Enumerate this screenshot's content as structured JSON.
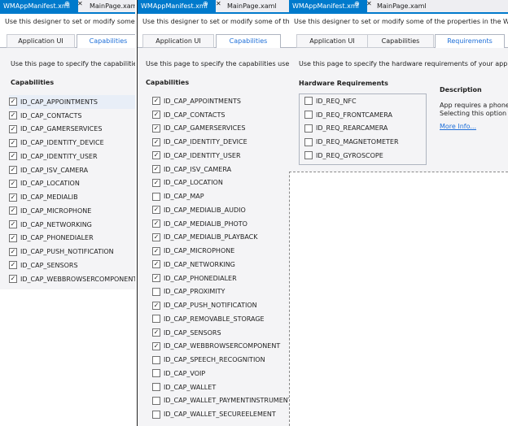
{
  "doc_tabs": {
    "manifest": "WMAppManifest.xml",
    "mainpage": "MainPage.xaml",
    "pin": "⊕",
    "close": "✕"
  },
  "designer_desc": "Use this designer to set or modify some of the properties in the Windows Phone",
  "designer_desc_short1": "Use this designer to set or modify some of the",
  "designer_desc_short2": "Use this designer to set or modify some of the proper",
  "tabs": {
    "app_ui": "Application UI",
    "capabilities": "Capabilities",
    "requirements": "Requirements"
  },
  "capabilities_page": {
    "intro": "Use this page to specify the capabilities used by you",
    "intro_short": "Use this page to specify the capabilities used",
    "section": "Capabilities"
  },
  "panel1_caps": [
    {
      "label": "ID_CAP_APPOINTMENTS",
      "checked": true
    },
    {
      "label": "ID_CAP_CONTACTS",
      "checked": true
    },
    {
      "label": "ID_CAP_GAMERSERVICES",
      "checked": true
    },
    {
      "label": "ID_CAP_IDENTITY_DEVICE",
      "checked": true
    },
    {
      "label": "ID_CAP_IDENTITY_USER",
      "checked": true
    },
    {
      "label": "ID_CAP_ISV_CAMERA",
      "checked": true
    },
    {
      "label": "ID_CAP_LOCATION",
      "checked": true
    },
    {
      "label": "ID_CAP_MEDIALIB",
      "checked": true
    },
    {
      "label": "ID_CAP_MICROPHONE",
      "checked": true
    },
    {
      "label": "ID_CAP_NETWORKING",
      "checked": true
    },
    {
      "label": "ID_CAP_PHONEDIALER",
      "checked": true
    },
    {
      "label": "ID_CAP_PUSH_NOTIFICATION",
      "checked": true
    },
    {
      "label": "ID_CAP_SENSORS",
      "checked": true
    },
    {
      "label": "ID_CAP_WEBBROWSERCOMPONENT",
      "checked": true
    }
  ],
  "panel2_caps": [
    {
      "label": "ID_CAP_APPOINTMENTS",
      "checked": true
    },
    {
      "label": "ID_CAP_CONTACTS",
      "checked": true
    },
    {
      "label": "ID_CAP_GAMERSERVICES",
      "checked": true
    },
    {
      "label": "ID_CAP_IDENTITY_DEVICE",
      "checked": true
    },
    {
      "label": "ID_CAP_IDENTITY_USER",
      "checked": true
    },
    {
      "label": "ID_CAP_ISV_CAMERA",
      "checked": true
    },
    {
      "label": "ID_CAP_LOCATION",
      "checked": true
    },
    {
      "label": "ID_CAP_MAP",
      "checked": false
    },
    {
      "label": "ID_CAP_MEDIALIB_AUDIO",
      "checked": true
    },
    {
      "label": "ID_CAP_MEDIALIB_PHOTO",
      "checked": true
    },
    {
      "label": "ID_CAP_MEDIALIB_PLAYBACK",
      "checked": true
    },
    {
      "label": "ID_CAP_MICROPHONE",
      "checked": true
    },
    {
      "label": "ID_CAP_NETWORKING",
      "checked": true
    },
    {
      "label": "ID_CAP_PHONEDIALER",
      "checked": true
    },
    {
      "label": "ID_CAP_PROXIMITY",
      "checked": false
    },
    {
      "label": "ID_CAP_PUSH_NOTIFICATION",
      "checked": true
    },
    {
      "label": "ID_CAP_REMOVABLE_STORAGE",
      "checked": false
    },
    {
      "label": "ID_CAP_SENSORS",
      "checked": true
    },
    {
      "label": "ID_CAP_WEBBROWSERCOMPONENT",
      "checked": true
    },
    {
      "label": "ID_CAP_SPEECH_RECOGNITION",
      "checked": false
    },
    {
      "label": "ID_CAP_VOIP",
      "checked": false
    },
    {
      "label": "ID_CAP_WALLET",
      "checked": false
    },
    {
      "label": "ID_CAP_WALLET_PAYMENTINSTRUMENTS",
      "checked": false
    },
    {
      "label": "ID_CAP_WALLET_SECUREELEMENT",
      "checked": false
    }
  ],
  "requirements_page": {
    "intro": "Use this page to specify the hardware requirements of your application.",
    "section": "Hardware Requirements",
    "items": [
      {
        "label": "ID_REQ_NFC",
        "checked": false
      },
      {
        "label": "ID_REQ_FRONTCAMERA",
        "checked": false
      },
      {
        "label": "ID_REQ_REARCAMERA",
        "checked": false
      },
      {
        "label": "ID_REQ_MAGNETOMETER",
        "checked": false
      },
      {
        "label": "ID_REQ_GYROSCOPE",
        "checked": false
      }
    ],
    "description_title": "Description",
    "description_line1": "App requires a phone wi",
    "description_line2": "Selecting this option pre",
    "more_info": "More Info..."
  },
  "colors": {
    "accent": "#007acc",
    "link": "#1e6fd9"
  }
}
